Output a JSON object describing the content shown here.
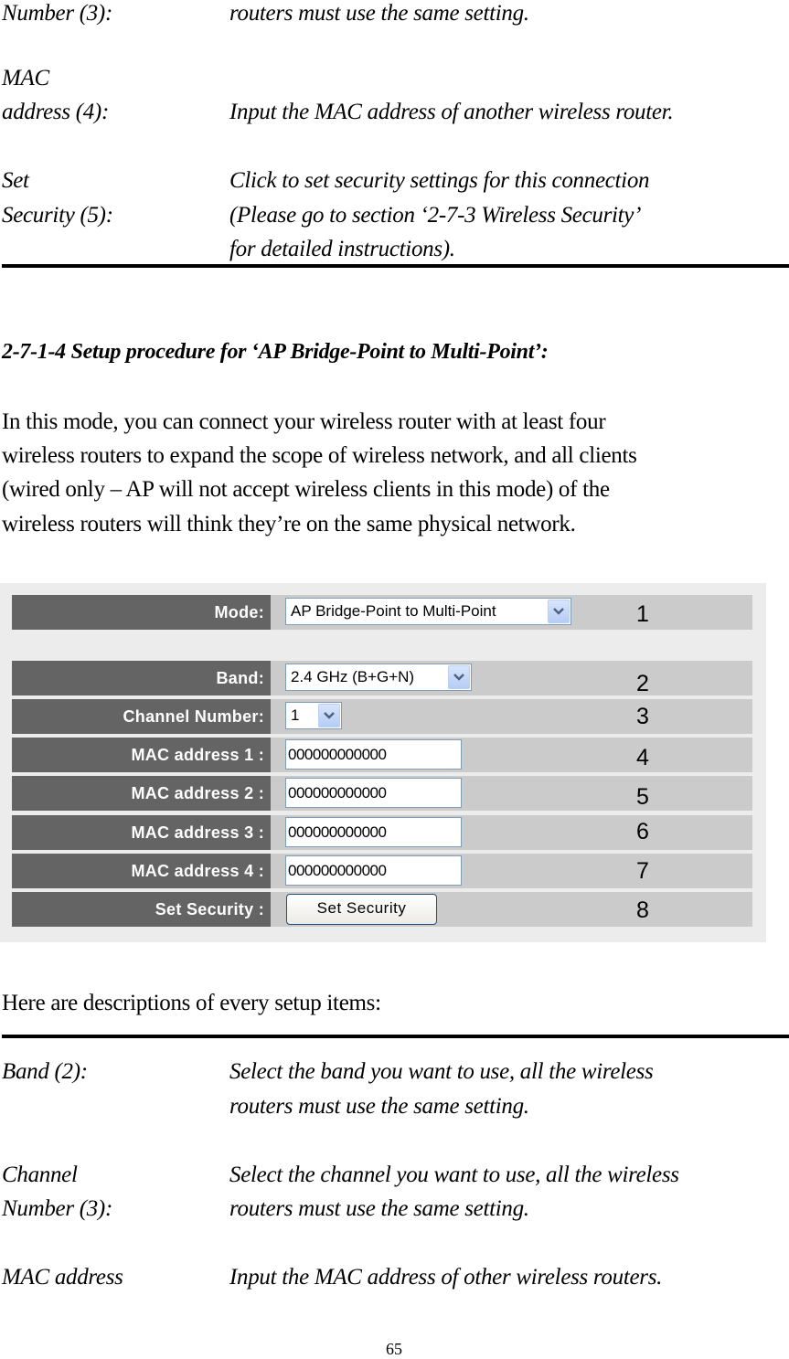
{
  "top_section": {
    "rows": [
      {
        "label_lines": [
          "Number (3):"
        ],
        "desc_lines": [
          "routers must use the same setting."
        ]
      },
      {
        "label_lines": [
          "MAC",
          "address (4):"
        ],
        "desc_lines": [
          "",
          "Input the MAC address of another wireless router."
        ]
      },
      {
        "label_lines": [
          "Set",
          "Security (5):"
        ],
        "desc_lines": [
          "Click to set security settings for this connection",
          "(Please go to section ‘2-7-3 Wireless Security’",
          "for detailed instructions)."
        ]
      }
    ]
  },
  "section": {
    "heading": "2-7-1-4 Setup procedure for ‘AP Bridge-Point to Multi-Point’:",
    "intro_lines": [
      "In this mode, you can connect your wireless router with at least four",
      "wireless routers to expand the scope of wireless network, and all clients",
      "(wired only – AP will not accept wireless clients in this mode) of the",
      "wireless routers will think they’re on the same physical network."
    ]
  },
  "screenshot": {
    "colors": {
      "label_bg": "#646464",
      "row_bg": "#cbcbcb",
      "panel_bg": "#ececec",
      "input_border": "#7f9db9"
    },
    "mode": {
      "label": "Mode:",
      "value": "AP Bridge-Point to Multi-Point",
      "callout": "1"
    },
    "band": {
      "label": "Band:",
      "value": "2.4 GHz (B+G+N)",
      "callout": "2"
    },
    "channel": {
      "label": "Channel Number:",
      "value": "1",
      "callout": "3"
    },
    "mac1": {
      "label": "MAC address 1 :",
      "value": "000000000000",
      "callout": "4"
    },
    "mac2": {
      "label": "MAC address 2 :",
      "value": "000000000000",
      "callout": "5"
    },
    "mac3": {
      "label": "MAC address 3 :",
      "value": "000000000000",
      "callout": "6"
    },
    "mac4": {
      "label": "MAC address 4 :",
      "value": "000000000000",
      "callout": "7"
    },
    "security": {
      "label": "Set Security :",
      "button_label": "Set Security",
      "callout": "8"
    }
  },
  "descriptions": {
    "intro": "Here are descriptions of every setup items:",
    "items": [
      {
        "label_lines": [
          "Band (2):"
        ],
        "desc_lines": [
          "Select the band you want to use, all the wireless",
          "routers must use the same setting."
        ]
      },
      {
        "label_lines": [
          "Channel",
          "Number (3):"
        ],
        "desc_lines": [
          "Select the channel you want to use, all the wireless",
          "routers must use the same setting."
        ]
      },
      {
        "label_lines": [
          "MAC address"
        ],
        "desc_lines": [
          "Input the MAC address of other wireless routers."
        ]
      }
    ]
  },
  "page_number": "65"
}
